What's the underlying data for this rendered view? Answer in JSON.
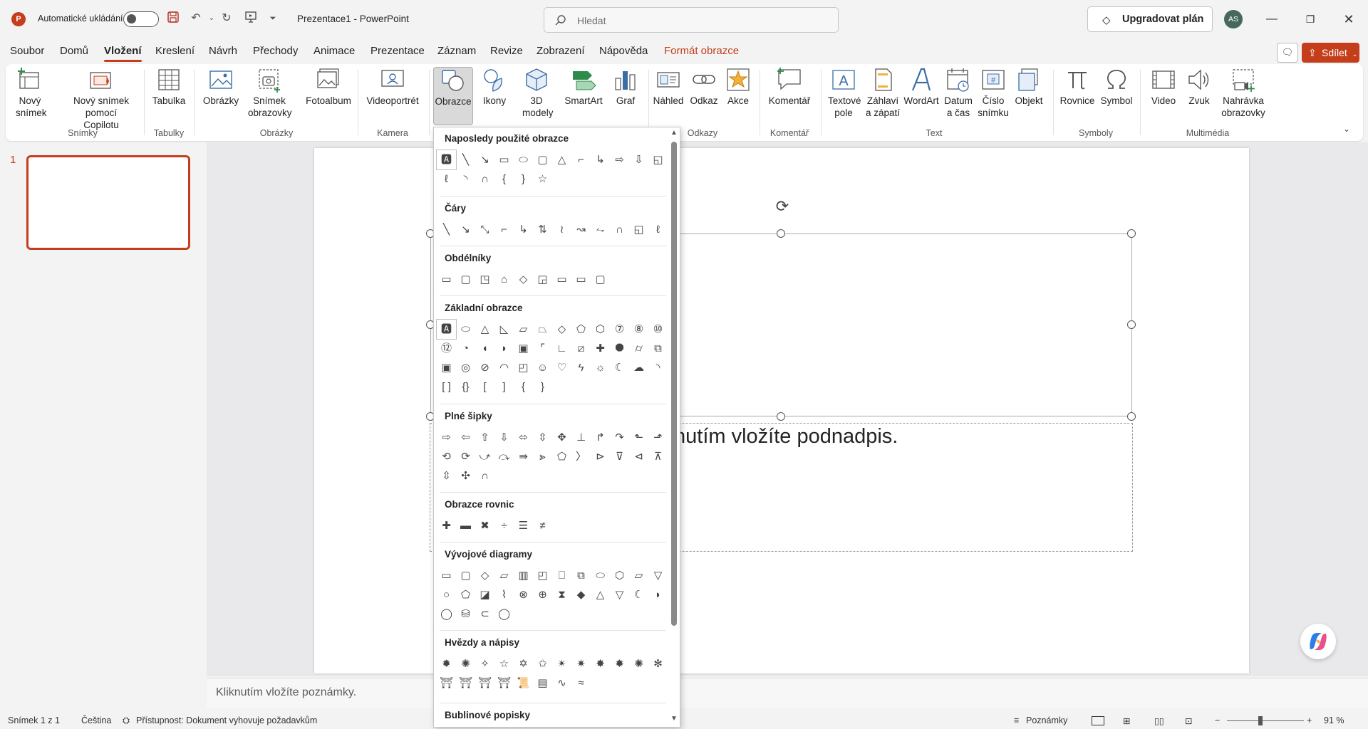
{
  "titlebar": {
    "app_icon": "P",
    "autosave_label": "Automatické ukládání",
    "doc_title": "Prezentace1 - PowerPoint",
    "search_placeholder": "Hledat",
    "upgrade_label": "Upgradovat plán",
    "avatar_initials": "AS"
  },
  "menu": {
    "tabs": [
      "Soubor",
      "Domů",
      "Vložení",
      "Kreslení",
      "Návrh",
      "Přechody",
      "Animace",
      "Prezentace",
      "Záznam",
      "Revize",
      "Zobrazení",
      "Nápověda",
      "Formát obrazce"
    ],
    "active_tab": "Vložení",
    "share_label": "Sdílet"
  },
  "ribbon": {
    "buttons": {
      "new_slide": "Nový snímek",
      "new_slide_copilot": "Nový snímek pomocí Copilotu",
      "table": "Tabulka",
      "images": "Obrázky",
      "screenshot": "Snímek obrazovky",
      "photo_album": "Fotoalbum",
      "video_portrait": "Videoportrét",
      "shapes": "Obrazce",
      "icons": "Ikony",
      "models_3d": "3D modely",
      "smartart": "SmartArt",
      "chart": "Graf",
      "preview": "Náhled",
      "link": "Odkaz",
      "action": "Akce",
      "comment": "Komentář",
      "textbox": "Textové pole",
      "header_footer": "Záhlaví a zápatí",
      "wordart": "WordArt",
      "date_time": "Datum a čas",
      "slide_number": "Číslo snímku",
      "object": "Objekt",
      "equation": "Rovnice",
      "symbol": "Symbol",
      "video": "Video",
      "audio": "Zvuk",
      "screen_recording": "Nahrávka obrazovky"
    },
    "groups": {
      "slides": "Snímky",
      "tables": "Tabulky",
      "images": "Obrázky",
      "camera": "Kamera",
      "links": "Odkazy",
      "comments": "Komentář",
      "text": "Text",
      "symbols": "Symboly",
      "multimedia": "Multimédia"
    }
  },
  "thumbnails": {
    "slide_number": "1"
  },
  "slide": {
    "subtitle_text": "nutím vložíte podnadpis."
  },
  "shapes_panel": {
    "sections": {
      "recent": "Naposledy použité obrazce",
      "lines": "Čáry",
      "rectangles": "Obdélníky",
      "basic": "Základní obrazce",
      "block_arrows": "Plné šipky",
      "equation": "Obrazce rovnic",
      "flowchart": "Vývojové diagramy",
      "stars": "Hvězdy a nápisy",
      "callouts": "Bublinové popisky"
    }
  },
  "notes": {
    "placeholder": "Kliknutím vložíte poznámky."
  },
  "status": {
    "slide_info": "Snímek 1 z 1",
    "language": "Čeština",
    "accessibility": "Přístupnost: Dokument vyhovuje požadavkům",
    "notes_label": "Poznámky",
    "zoom": "91 %"
  },
  "colors": {
    "accent": "#c43e1c",
    "ribbon_bg": "#ffffff",
    "window_bg": "#f3f3f3"
  }
}
